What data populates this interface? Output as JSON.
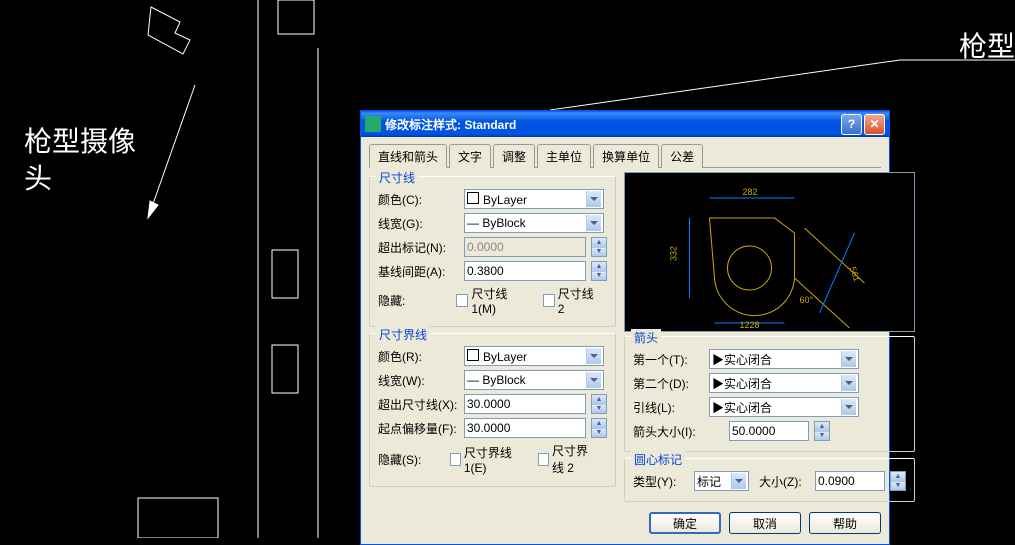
{
  "cad": {
    "label_left_line1": "枪型摄像",
    "label_left_line2": "头",
    "label_right": "枪型"
  },
  "dialog": {
    "title": "修改标注样式: Standard",
    "tabs": [
      "直线和箭头",
      "文字",
      "调整",
      "主单位",
      "换算单位",
      "公差"
    ],
    "active_tab": 0,
    "dim_line": {
      "title": "尺寸线",
      "color_label": "颜色(C):",
      "color_value": "ByLayer",
      "lineweight_label": "线宽(G):",
      "lineweight_value": "— ByBlock",
      "extend_label": "超出标记(N):",
      "extend_value": "0.0000",
      "baseline_label": "基线间距(A):",
      "baseline_value": "0.3800",
      "hide_label": "隐藏:",
      "hide1": "尺寸线 1(M)",
      "hide2": "尺寸线 2"
    },
    "ext_line": {
      "title": "尺寸界线",
      "color_label": "颜色(R):",
      "color_value": "ByLayer",
      "lineweight_label": "线宽(W):",
      "lineweight_value": "— ByBlock",
      "extend_label": "超出尺寸线(X):",
      "extend_value": "30.0000",
      "offset_label": "起点偏移量(F):",
      "offset_value": "30.0000",
      "hide_label": "隐藏(S):",
      "hide1": "尺寸界线 1(E)",
      "hide2": "尺寸界线 2"
    },
    "preview": {
      "dim_top": "282",
      "dim_left": "332",
      "dim_right": "561",
      "dim_angle": "60°",
      "dim_bottom": "1228"
    },
    "arrows": {
      "title": "箭头",
      "first_label": "第一个(T):",
      "second_label": "第二个(D):",
      "leader_label": "引线(L):",
      "arrow_value": "实心闭合",
      "size_label": "箭头大小(I):",
      "size_value": "50.0000"
    },
    "center": {
      "title": "圆心标记",
      "type_label": "类型(Y):",
      "type_value": "标记",
      "size_label": "大小(Z):",
      "size_value": "0.0900"
    },
    "buttons": {
      "ok": "确定",
      "cancel": "取消",
      "help": "帮助"
    }
  }
}
